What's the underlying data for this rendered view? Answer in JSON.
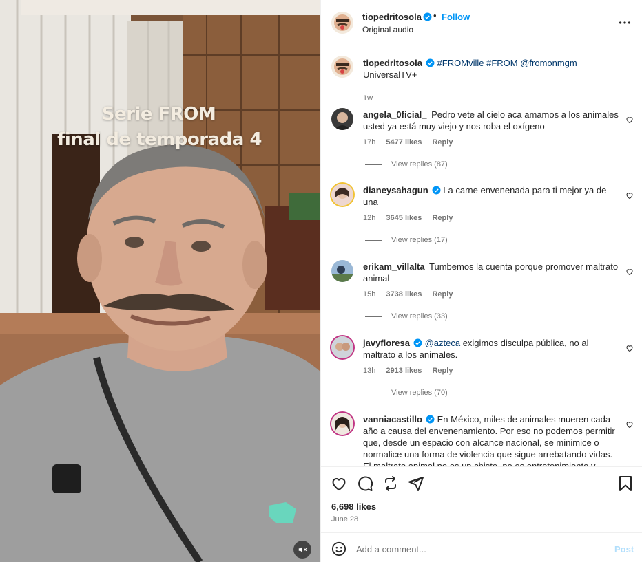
{
  "post": {
    "author": "tiopedritosola",
    "follow_label": "Follow",
    "separator": "•",
    "audio": "Original audio",
    "more_icon": "more-horizontal-icon"
  },
  "media": {
    "overlay_line1": "Serie FROM",
    "overlay_line2": "final de temporada 4",
    "mute_icon": "speaker-muted-icon"
  },
  "caption": {
    "username": "tiopedritosola",
    "tags": "#FROMville #FROM @fromonmgm",
    "text": "UniversalTV+",
    "time": "1w"
  },
  "comments": [
    {
      "username": "angela_0ficial_",
      "verified": false,
      "text": "Pedro vete al cielo aca amamos a los animales usted ya está muy viejo y nos roba el oxígeno",
      "mention": "",
      "time": "17h",
      "likes": "5477 likes",
      "reply": "Reply",
      "view_replies": "View replies (87)"
    },
    {
      "username": "dianeysahagun",
      "verified": true,
      "text": "La carne envenenada para ti mejor ya de una",
      "mention": "",
      "time": "12h",
      "likes": "3645 likes",
      "reply": "Reply",
      "view_replies": "View replies (17)"
    },
    {
      "username": "erikam_villalta",
      "verified": false,
      "text": "Tumbemos la cuenta porque promover maltrato animal",
      "mention": "",
      "time": "15h",
      "likes": "3738 likes",
      "reply": "Reply",
      "view_replies": "View replies (33)"
    },
    {
      "username": "javyfloresa",
      "verified": true,
      "text": "exigimos disculpa pública, no al maltrato a los animales.",
      "mention": "@azteca",
      "time": "13h",
      "likes": "2913 likes",
      "reply": "Reply",
      "view_replies": "View replies (70)"
    },
    {
      "username": "vanniacastillo",
      "verified": true,
      "text": "En México, miles de animales mueren cada año a causa del envenenamiento. Por eso no podemos permitir que, desde un espacio con alcance nacional, se minimice o normalice una forma de violencia que sigue arrebatando vidas. El maltrato animal no es un chiste, no es entretenimiento y",
      "mention": "",
      "time": "",
      "likes": "",
      "reply": "",
      "view_replies": ""
    }
  ],
  "actions": {
    "like_icon": "heart-icon",
    "comment_icon": "comment-icon",
    "share_icon": "repost-icon",
    "send_icon": "send-icon",
    "save_icon": "bookmark-icon",
    "likes": "6,698 likes",
    "date": "June 28"
  },
  "composer": {
    "placeholder": "Add a comment...",
    "post_label": "Post",
    "emoji_icon": "emoji-icon"
  },
  "colors": {
    "accent": "#0095f6",
    "link": "#00376b",
    "muted": "#737373",
    "post_disabled": "#b2dffc"
  }
}
